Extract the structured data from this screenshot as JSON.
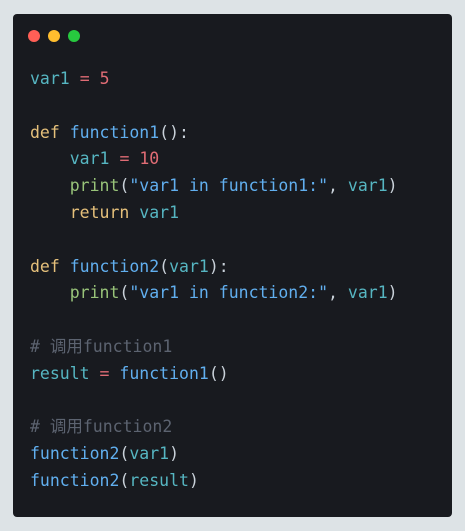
{
  "window": {
    "buttons": [
      {
        "name": "close-button",
        "color": "#ff5f56"
      },
      {
        "name": "minimize-button",
        "color": "#ffbd2e"
      },
      {
        "name": "maximize-button",
        "color": "#27c93f"
      }
    ]
  },
  "colors": {
    "kw": "#e5c07b",
    "fn": "#61afef",
    "var": "#56b6c2",
    "num": "#e06c75",
    "str": "#98c379",
    "punc": "#c9d1d9",
    "op": "#e06c75",
    "comment": "#5c6370",
    "builtin": "#98c379"
  },
  "code_lines": [
    [
      {
        "t": "var1",
        "c": "var"
      },
      {
        "t": " ",
        "c": "punc"
      },
      {
        "t": "=",
        "c": "op"
      },
      {
        "t": " ",
        "c": "punc"
      },
      {
        "t": "5",
        "c": "num"
      }
    ],
    [],
    [
      {
        "t": "def",
        "c": "kw"
      },
      {
        "t": " ",
        "c": "punc"
      },
      {
        "t": "function1",
        "c": "fn"
      },
      {
        "t": "():",
        "c": "punc"
      }
    ],
    [
      {
        "t": "    ",
        "c": "punc"
      },
      {
        "t": "var1",
        "c": "var"
      },
      {
        "t": " ",
        "c": "punc"
      },
      {
        "t": "=",
        "c": "op"
      },
      {
        "t": " ",
        "c": "punc"
      },
      {
        "t": "10",
        "c": "num"
      }
    ],
    [
      {
        "t": "    ",
        "c": "punc"
      },
      {
        "t": "print",
        "c": "builtin"
      },
      {
        "t": "(",
        "c": "punc"
      },
      {
        "t": "\"var1 in function1:\"",
        "c": "fn"
      },
      {
        "t": ", ",
        "c": "punc"
      },
      {
        "t": "var1",
        "c": "var"
      },
      {
        "t": ")",
        "c": "punc"
      }
    ],
    [
      {
        "t": "    ",
        "c": "punc"
      },
      {
        "t": "return",
        "c": "kw"
      },
      {
        "t": " ",
        "c": "punc"
      },
      {
        "t": "var1",
        "c": "var"
      }
    ],
    [],
    [
      {
        "t": "def",
        "c": "kw"
      },
      {
        "t": " ",
        "c": "punc"
      },
      {
        "t": "function2",
        "c": "fn"
      },
      {
        "t": "(",
        "c": "punc"
      },
      {
        "t": "var1",
        "c": "var"
      },
      {
        "t": "):",
        "c": "punc"
      }
    ],
    [
      {
        "t": "    ",
        "c": "punc"
      },
      {
        "t": "print",
        "c": "builtin"
      },
      {
        "t": "(",
        "c": "punc"
      },
      {
        "t": "\"var1 in function2:\"",
        "c": "fn"
      },
      {
        "t": ", ",
        "c": "punc"
      },
      {
        "t": "var1",
        "c": "var"
      },
      {
        "t": ")",
        "c": "punc"
      }
    ],
    [],
    [
      {
        "t": "# 调用function1",
        "c": "comment"
      }
    ],
    [
      {
        "t": "result",
        "c": "var"
      },
      {
        "t": " ",
        "c": "punc"
      },
      {
        "t": "=",
        "c": "op"
      },
      {
        "t": " ",
        "c": "punc"
      },
      {
        "t": "function1",
        "c": "fn"
      },
      {
        "t": "()",
        "c": "punc"
      }
    ],
    [],
    [
      {
        "t": "# 调用function2",
        "c": "comment"
      }
    ],
    [
      {
        "t": "function2",
        "c": "fn"
      },
      {
        "t": "(",
        "c": "punc"
      },
      {
        "t": "var1",
        "c": "var"
      },
      {
        "t": ")",
        "c": "punc"
      }
    ],
    [
      {
        "t": "function2",
        "c": "fn"
      },
      {
        "t": "(",
        "c": "punc"
      },
      {
        "t": "result",
        "c": "var"
      },
      {
        "t": ")",
        "c": "punc"
      }
    ]
  ]
}
